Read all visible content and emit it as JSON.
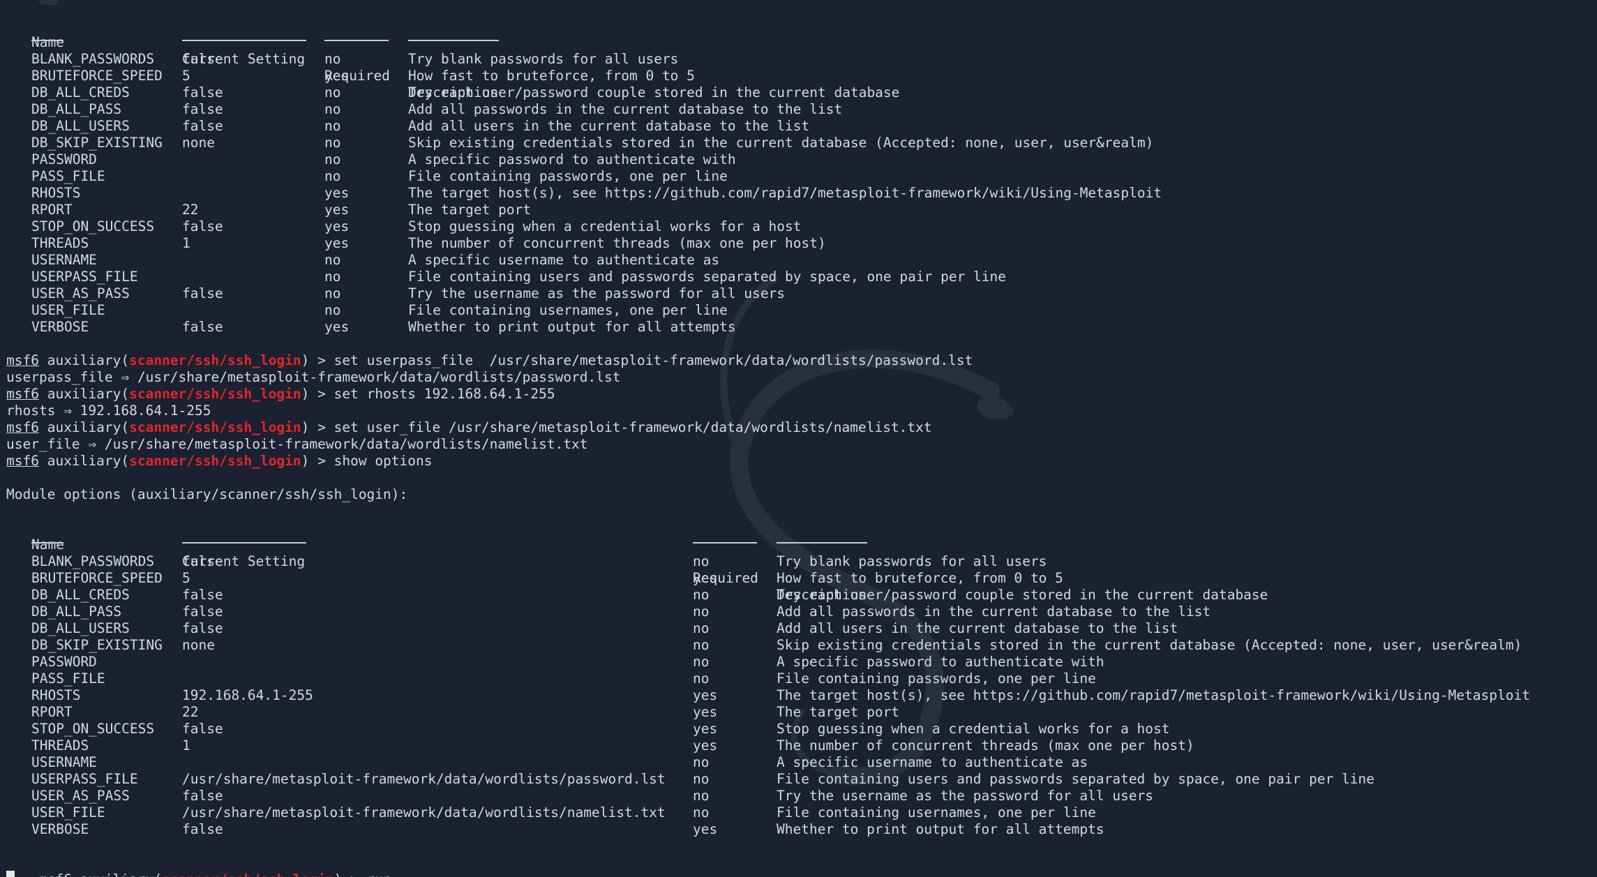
{
  "prompt": {
    "msf": "msf6",
    "prefix": " auxiliary(",
    "module": "scanner/ssh/ssh_login",
    "suffix": ") > "
  },
  "table1": {
    "headers": [
      "Name",
      "Current Setting",
      "Required",
      "Description"
    ],
    "rows": [
      [
        "BLANK_PASSWORDS",
        "false",
        "no",
        "Try blank passwords for all users"
      ],
      [
        "BRUTEFORCE_SPEED",
        "5",
        "yes",
        "How fast to bruteforce, from 0 to 5"
      ],
      [
        "DB_ALL_CREDS",
        "false",
        "no",
        "Try each user/password couple stored in the current database"
      ],
      [
        "DB_ALL_PASS",
        "false",
        "no",
        "Add all passwords in the current database to the list"
      ],
      [
        "DB_ALL_USERS",
        "false",
        "no",
        "Add all users in the current database to the list"
      ],
      [
        "DB_SKIP_EXISTING",
        "none",
        "no",
        "Skip existing credentials stored in the current database (Accepted: none, user, user&realm)"
      ],
      [
        "PASSWORD",
        "",
        "no",
        "A specific password to authenticate with"
      ],
      [
        "PASS_FILE",
        "",
        "no",
        "File containing passwords, one per line"
      ],
      [
        "RHOSTS",
        "",
        "yes",
        "The target host(s), see https://github.com/rapid7/metasploit-framework/wiki/Using-Metasploit"
      ],
      [
        "RPORT",
        "22",
        "yes",
        "The target port"
      ],
      [
        "STOP_ON_SUCCESS",
        "false",
        "yes",
        "Stop guessing when a credential works for a host"
      ],
      [
        "THREADS",
        "1",
        "yes",
        "The number of concurrent threads (max one per host)"
      ],
      [
        "USERNAME",
        "",
        "no",
        "A specific username to authenticate as"
      ],
      [
        "USERPASS_FILE",
        "",
        "no",
        "File containing users and passwords separated by space, one pair per line"
      ],
      [
        "USER_AS_PASS",
        "false",
        "no",
        "Try the username as the password for all users"
      ],
      [
        "USER_FILE",
        "",
        "no",
        "File containing usernames, one per line"
      ],
      [
        "VERBOSE",
        "false",
        "yes",
        "Whether to print output for all attempts"
      ]
    ]
  },
  "commands": [
    {
      "cmd": "set userpass_file  /usr/share/metasploit-framework/data/wordlists/password.lst",
      "output": "userpass_file ⇒ /usr/share/metasploit-framework/data/wordlists/password.lst"
    },
    {
      "cmd": "set rhosts 192.168.64.1-255",
      "output": "rhosts ⇒ 192.168.64.1-255"
    },
    {
      "cmd": "set user_file /usr/share/metasploit-framework/data/wordlists/namelist.txt",
      "output": "user_file ⇒ /usr/share/metasploit-framework/data/wordlists/namelist.txt"
    },
    {
      "cmd": "show options",
      "output": ""
    }
  ],
  "module_options_title": "Module options (auxiliary/scanner/ssh/ssh_login):",
  "table2": {
    "headers": [
      "Name",
      "Current Setting",
      "Required",
      "Description"
    ],
    "rows": [
      [
        "BLANK_PASSWORDS",
        "false",
        "no",
        "Try blank passwords for all users"
      ],
      [
        "BRUTEFORCE_SPEED",
        "5",
        "yes",
        "How fast to bruteforce, from 0 to 5"
      ],
      [
        "DB_ALL_CREDS",
        "false",
        "no",
        "Try each user/password couple stored in the current database"
      ],
      [
        "DB_ALL_PASS",
        "false",
        "no",
        "Add all passwords in the current database to the list"
      ],
      [
        "DB_ALL_USERS",
        "false",
        "no",
        "Add all users in the current database to the list"
      ],
      [
        "DB_SKIP_EXISTING",
        "none",
        "no",
        "Skip existing credentials stored in the current database (Accepted: none, user, user&realm)"
      ],
      [
        "PASSWORD",
        "",
        "no",
        "A specific password to authenticate with"
      ],
      [
        "PASS_FILE",
        "",
        "no",
        "File containing passwords, one per line"
      ],
      [
        "RHOSTS",
        "192.168.64.1-255",
        "yes",
        "The target host(s), see https://github.com/rapid7/metasploit-framework/wiki/Using-Metasploit"
      ],
      [
        "RPORT",
        "22",
        "yes",
        "The target port"
      ],
      [
        "STOP_ON_SUCCESS",
        "false",
        "yes",
        "Stop guessing when a credential works for a host"
      ],
      [
        "THREADS",
        "1",
        "yes",
        "The number of concurrent threads (max one per host)"
      ],
      [
        "USERNAME",
        "",
        "no",
        "A specific username to authenticate as"
      ],
      [
        "USERPASS_FILE",
        "/usr/share/metasploit-framework/data/wordlists/password.lst",
        "no",
        "File containing users and passwords separated by space, one pair per line"
      ],
      [
        "USER_AS_PASS",
        "false",
        "no",
        "Try the username as the password for all users"
      ],
      [
        "USER_FILE",
        "/usr/share/metasploit-framework/data/wordlists/namelist.txt",
        "no",
        "File containing usernames, one per line"
      ],
      [
        "VERBOSE",
        "false",
        "yes",
        "Whether to print output for all attempts"
      ]
    ]
  },
  "final_command": "run",
  "colors": {
    "background": "#1b2130",
    "text": "#d4d8e0",
    "module": "#e3262a"
  }
}
